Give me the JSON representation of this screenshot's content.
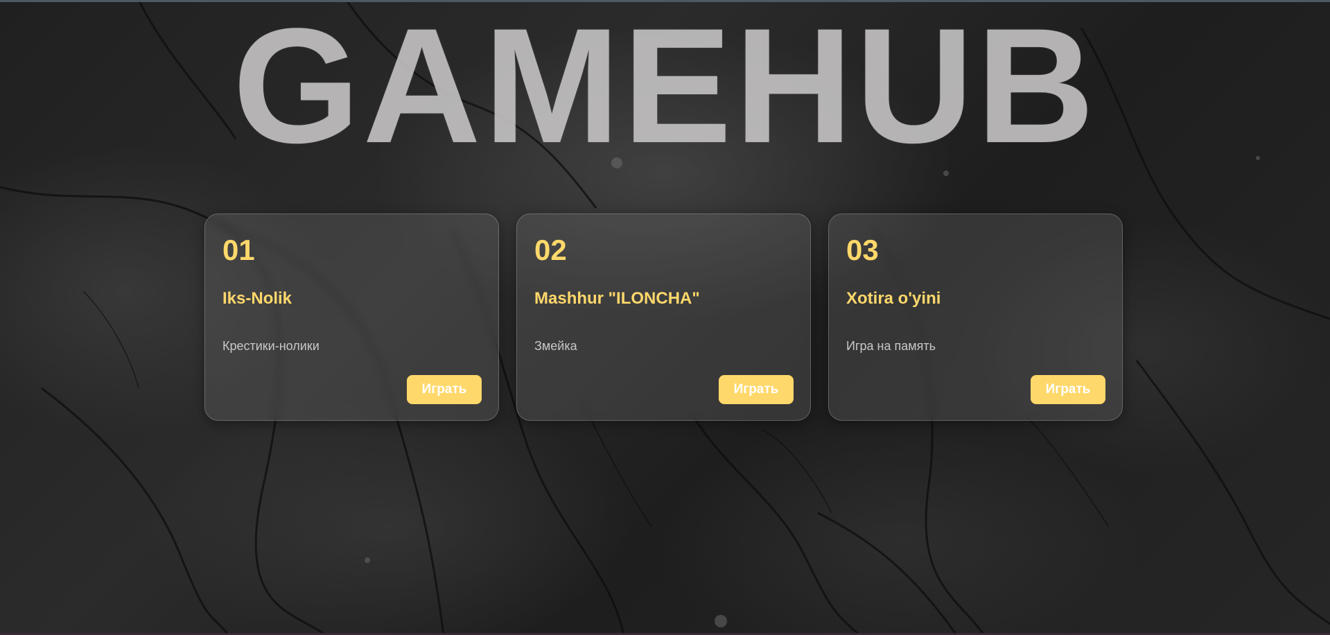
{
  "header": {
    "title": "GAMEHUB"
  },
  "colors": {
    "accent": "#ffd86b",
    "card_text": "#c8c8c8",
    "title": "#c9c7c7"
  },
  "cards": [
    {
      "number": "01",
      "title": "Iks-Nolik",
      "description": "Крестики-нолики",
      "button_label": "Играть"
    },
    {
      "number": "02",
      "title": "Mashhur \"ILONCHA\"",
      "description": "Змейка",
      "button_label": "Играть"
    },
    {
      "number": "03",
      "title": "Xotira o'yini",
      "description": "Игра на память",
      "button_label": "Играть"
    }
  ]
}
